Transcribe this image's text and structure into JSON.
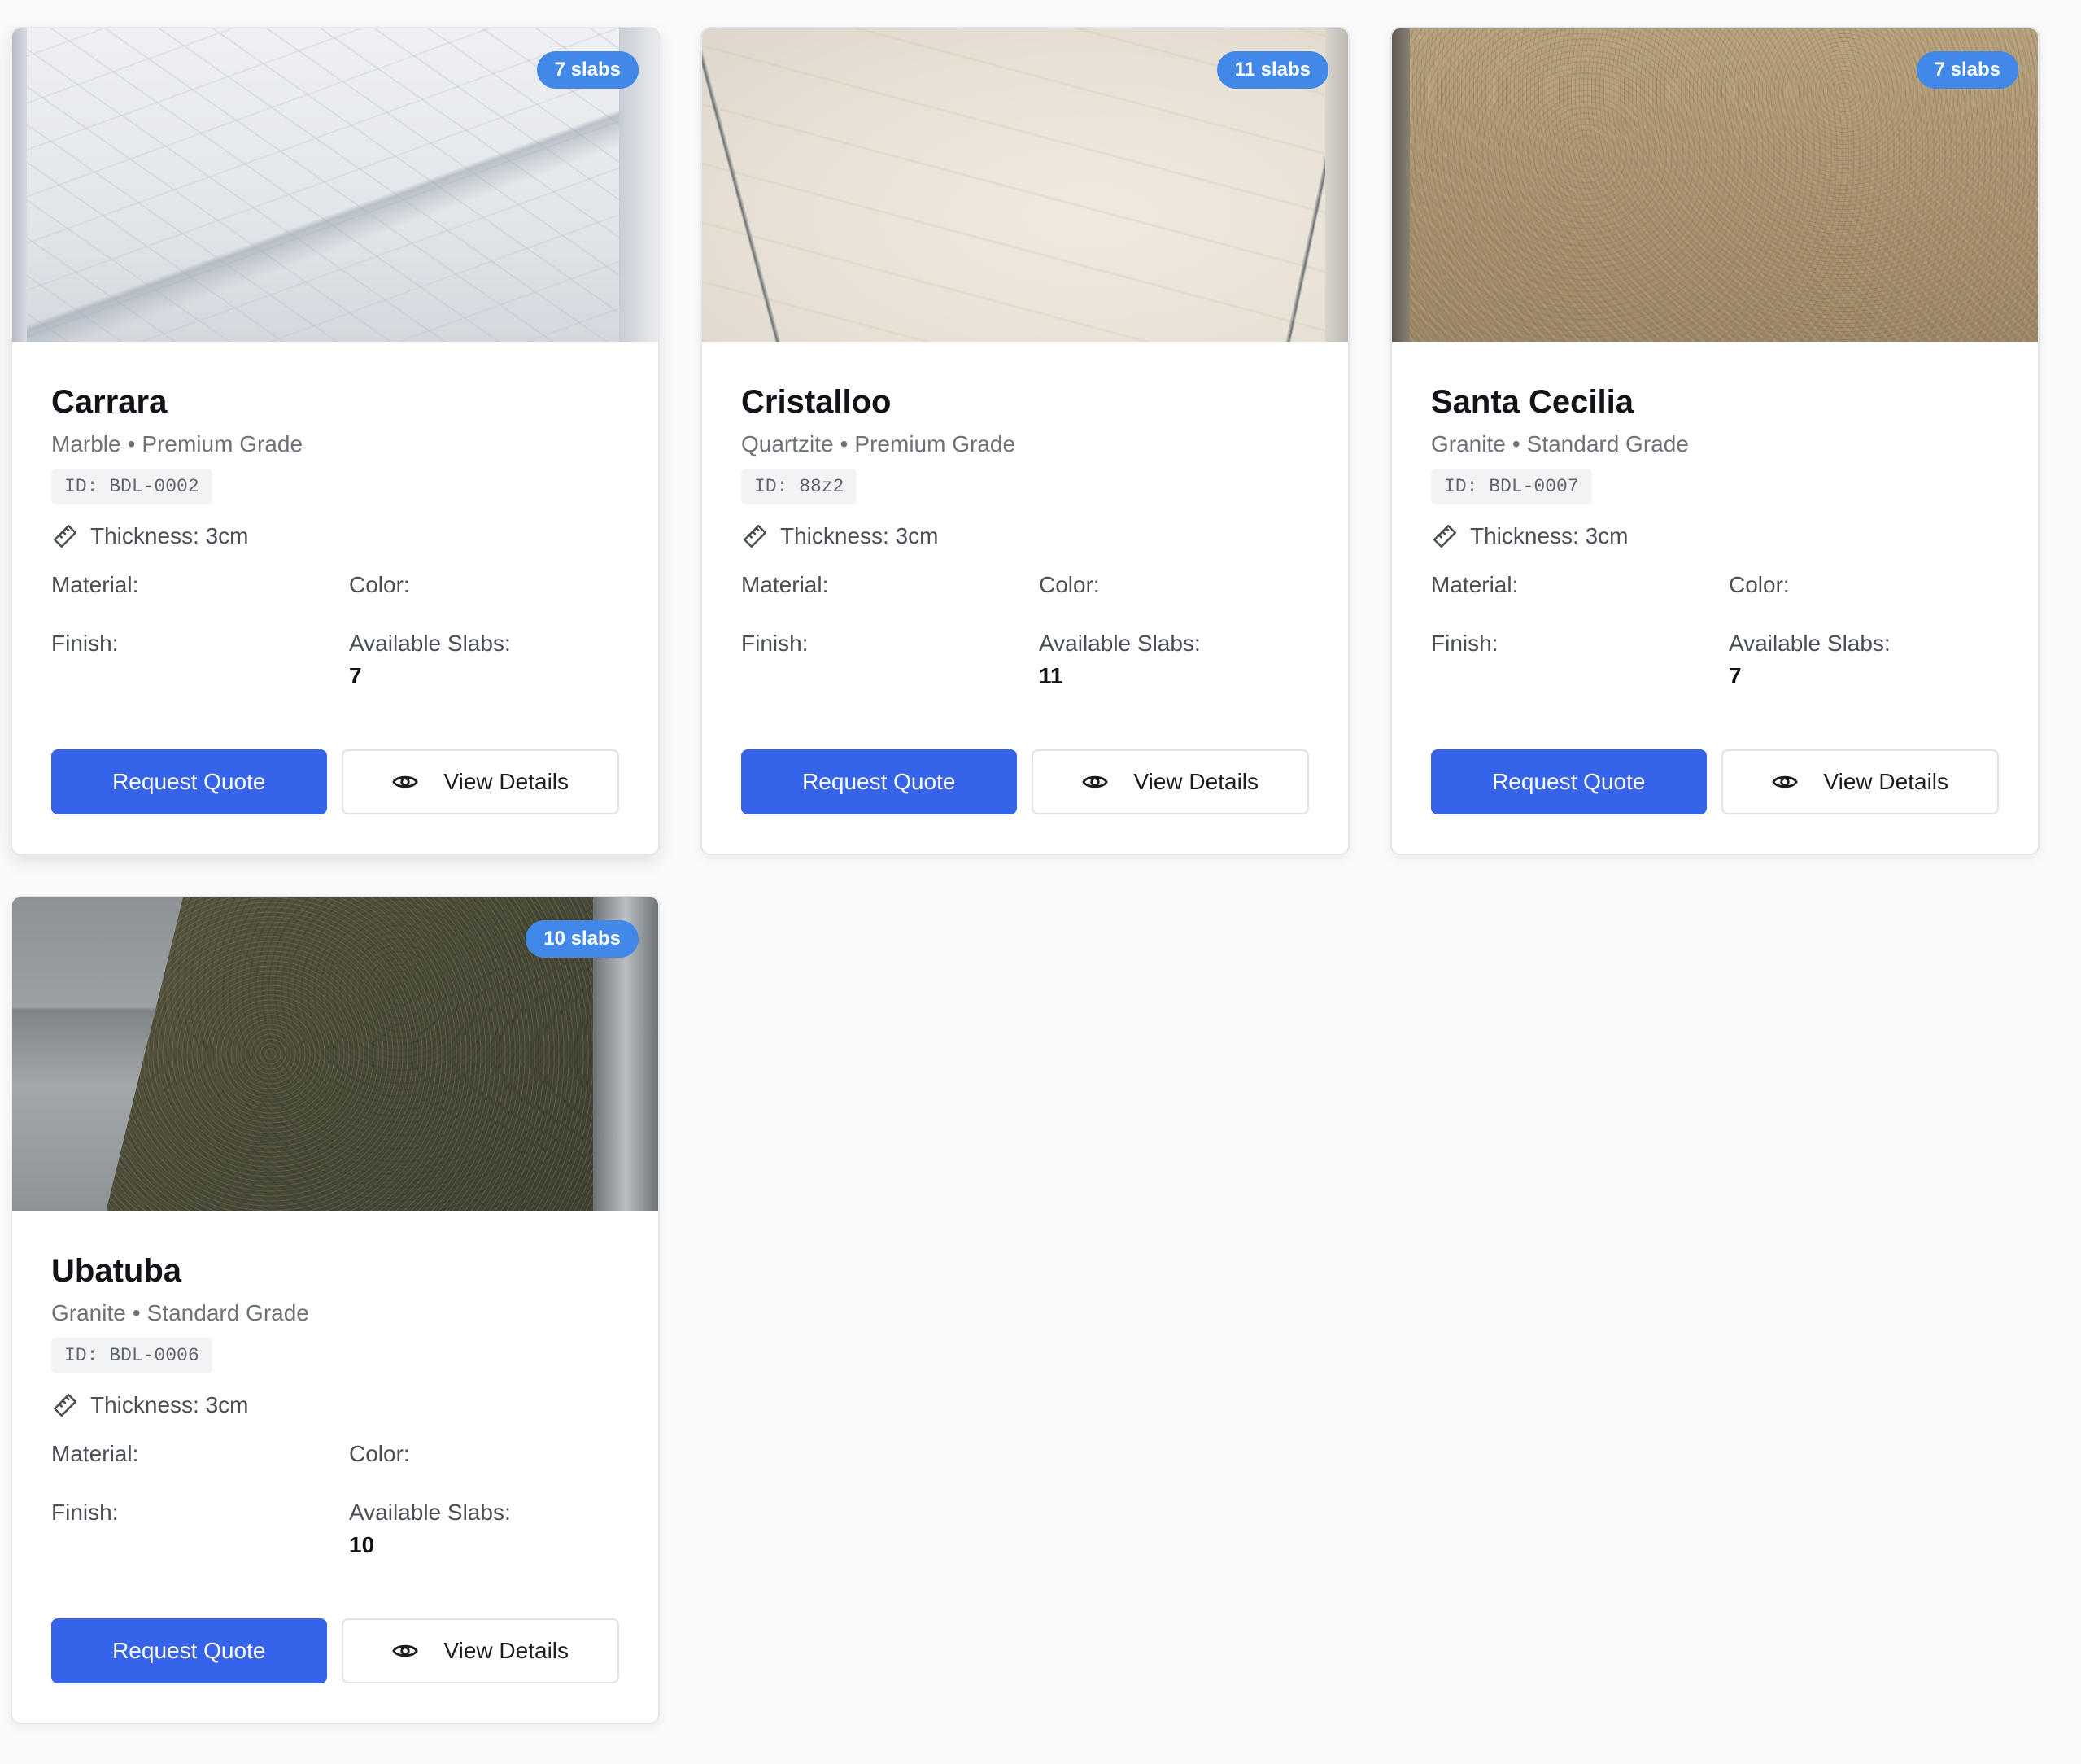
{
  "cards": [
    {
      "name": "Carrara",
      "type": "Marble",
      "grade": "Premium Grade",
      "id_text": "ID: BDL-0002",
      "badge": "7 slabs",
      "thickness": "Thickness: 3cm",
      "material_label": "Material:",
      "color_label": "Color:",
      "finish_label": "Finish:",
      "slabs_label": "Available Slabs:",
      "slabs_value": "7",
      "quote_label": "Request Quote",
      "details_label": "View Details"
    },
    {
      "name": "Cristalloo",
      "type": "Quartzite",
      "grade": "Premium Grade",
      "id_text": "ID: 88z2",
      "badge": "11 slabs",
      "thickness": "Thickness: 3cm",
      "material_label": "Material:",
      "color_label": "Color:",
      "finish_label": "Finish:",
      "slabs_label": "Available Slabs:",
      "slabs_value": "11",
      "quote_label": "Request Quote",
      "details_label": "View Details"
    },
    {
      "name": "Santa Cecilia",
      "type": "Granite",
      "grade": "Standard Grade",
      "id_text": "ID: BDL-0007",
      "badge": "7 slabs",
      "thickness": "Thickness: 3cm",
      "material_label": "Material:",
      "color_label": "Color:",
      "finish_label": "Finish:",
      "slabs_label": "Available Slabs:",
      "slabs_value": "7",
      "quote_label": "Request Quote",
      "details_label": "View Details"
    },
    {
      "name": "Ubatuba",
      "type": "Granite",
      "grade": "Standard Grade",
      "id_text": "ID: BDL-0006",
      "badge": "10 slabs",
      "thickness": "Thickness: 3cm",
      "material_label": "Material:",
      "color_label": "Color:",
      "finish_label": "Finish:",
      "slabs_label": "Available Slabs:",
      "slabs_value": "10",
      "quote_label": "Request Quote",
      "details_label": "View Details"
    }
  ],
  "separator": "•",
  "icons": {
    "thickness": "ruler-icon",
    "view": "eye-icon"
  },
  "colors": {
    "primary": "#3563e9",
    "badge": "#4188e8"
  }
}
